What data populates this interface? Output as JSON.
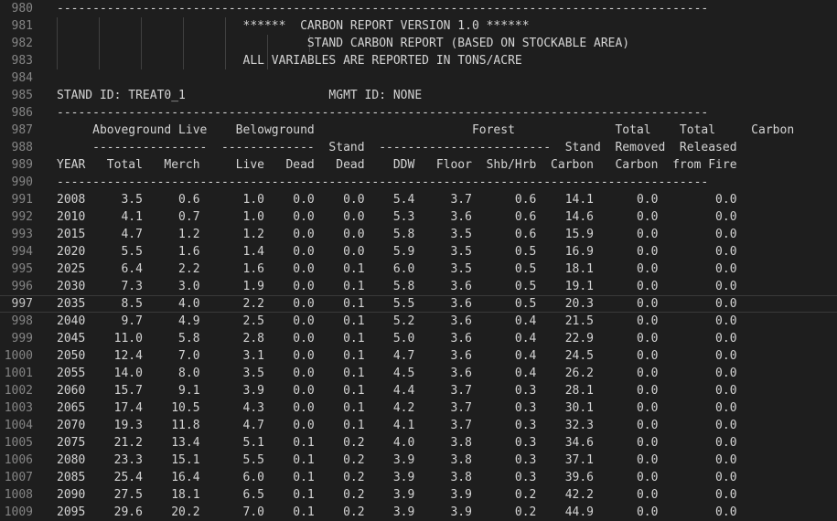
{
  "editor": {
    "current_line": "997",
    "lines": [
      {
        "n": "980",
        "text": "-------------------------------------------------------------------------------------------"
      },
      {
        "n": "981",
        "text": "                          ******  CARBON REPORT VERSION 1.0 ******"
      },
      {
        "n": "982",
        "text": "                                   STAND CARBON REPORT (BASED ON STOCKABLE AREA)"
      },
      {
        "n": "983",
        "text": "                          ALL VARIABLES ARE REPORTED IN TONS/ACRE"
      },
      {
        "n": "984",
        "text": ""
      },
      {
        "n": "985",
        "text": "STAND ID: TREAT0_1                    MGMT ID: NONE"
      },
      {
        "n": "986",
        "text": "-------------------------------------------------------------------------------------------"
      },
      {
        "n": "987",
        "text": "     Aboveground Live    Belowground                      Forest              Total    Total     Carbon"
      },
      {
        "n": "988",
        "text": "     ----------------  -------------  Stand  ------------------------  Stand  Removed  Released"
      },
      {
        "n": "989",
        "text": "YEAR   Total   Merch     Live   Dead   Dead    DDW   Floor  Shb/Hrb  Carbon   Carbon  from Fire"
      },
      {
        "n": "990",
        "text": "-------------------------------------------------------------------------------------------"
      },
      {
        "n": "991",
        "text": "2008     3.5     0.6      1.0    0.0    0.0    5.4     3.7      0.6    14.1      0.0        0.0"
      },
      {
        "n": "992",
        "text": "2010     4.1     0.7      1.0    0.0    0.0    5.3     3.6      0.6    14.6      0.0        0.0"
      },
      {
        "n": "993",
        "text": "2015     4.7     1.2      1.2    0.0    0.0    5.8     3.5      0.6    15.9      0.0        0.0"
      },
      {
        "n": "994",
        "text": "2020     5.5     1.6      1.4    0.0    0.0    5.9     3.5      0.5    16.9      0.0        0.0"
      },
      {
        "n": "995",
        "text": "2025     6.4     2.2      1.6    0.0    0.1    6.0     3.5      0.5    18.1      0.0        0.0"
      },
      {
        "n": "996",
        "text": "2030     7.3     3.0      1.9    0.0    0.1    5.8     3.6      0.5    19.1      0.0        0.0"
      },
      {
        "n": "997",
        "text": "2035     8.5     4.0      2.2    0.0    0.1    5.5     3.6      0.5    20.3      0.0        0.0"
      },
      {
        "n": "998",
        "text": "2040     9.7     4.9      2.5    0.0    0.1    5.2     3.6      0.4    21.5      0.0        0.0"
      },
      {
        "n": "999",
        "text": "2045    11.0     5.8      2.8    0.0    0.1    5.0     3.6      0.4    22.9      0.0        0.0"
      },
      {
        "n": "1000",
        "text": "2050    12.4     7.0      3.1    0.0    0.1    4.7     3.6      0.4    24.5      0.0        0.0"
      },
      {
        "n": "1001",
        "text": "2055    14.0     8.0      3.5    0.0    0.1    4.5     3.6      0.4    26.2      0.0        0.0"
      },
      {
        "n": "1002",
        "text": "2060    15.7     9.1      3.9    0.0    0.1    4.4     3.7      0.3    28.1      0.0        0.0"
      },
      {
        "n": "1003",
        "text": "2065    17.4    10.5      4.3    0.0    0.1    4.2     3.7      0.3    30.1      0.0        0.0"
      },
      {
        "n": "1004",
        "text": "2070    19.3    11.8      4.7    0.0    0.1    4.1     3.7      0.3    32.3      0.0        0.0"
      },
      {
        "n": "1005",
        "text": "2075    21.2    13.4      5.1    0.1    0.2    4.0     3.8      0.3    34.6      0.0        0.0"
      },
      {
        "n": "1006",
        "text": "2080    23.3    15.1      5.5    0.1    0.2    3.9     3.8      0.3    37.1      0.0        0.0"
      },
      {
        "n": "1007",
        "text": "2085    25.4    16.4      6.0    0.1    0.2    3.9     3.8      0.3    39.6      0.0        0.0"
      },
      {
        "n": "1008",
        "text": "2090    27.5    18.1      6.5    0.1    0.2    3.9     3.9      0.2    42.2      0.0        0.0"
      },
      {
        "n": "1009",
        "text": "2095    29.6    20.2      7.0    0.1    0.2    3.9     3.9      0.2    44.9      0.0        0.0"
      }
    ]
  }
}
